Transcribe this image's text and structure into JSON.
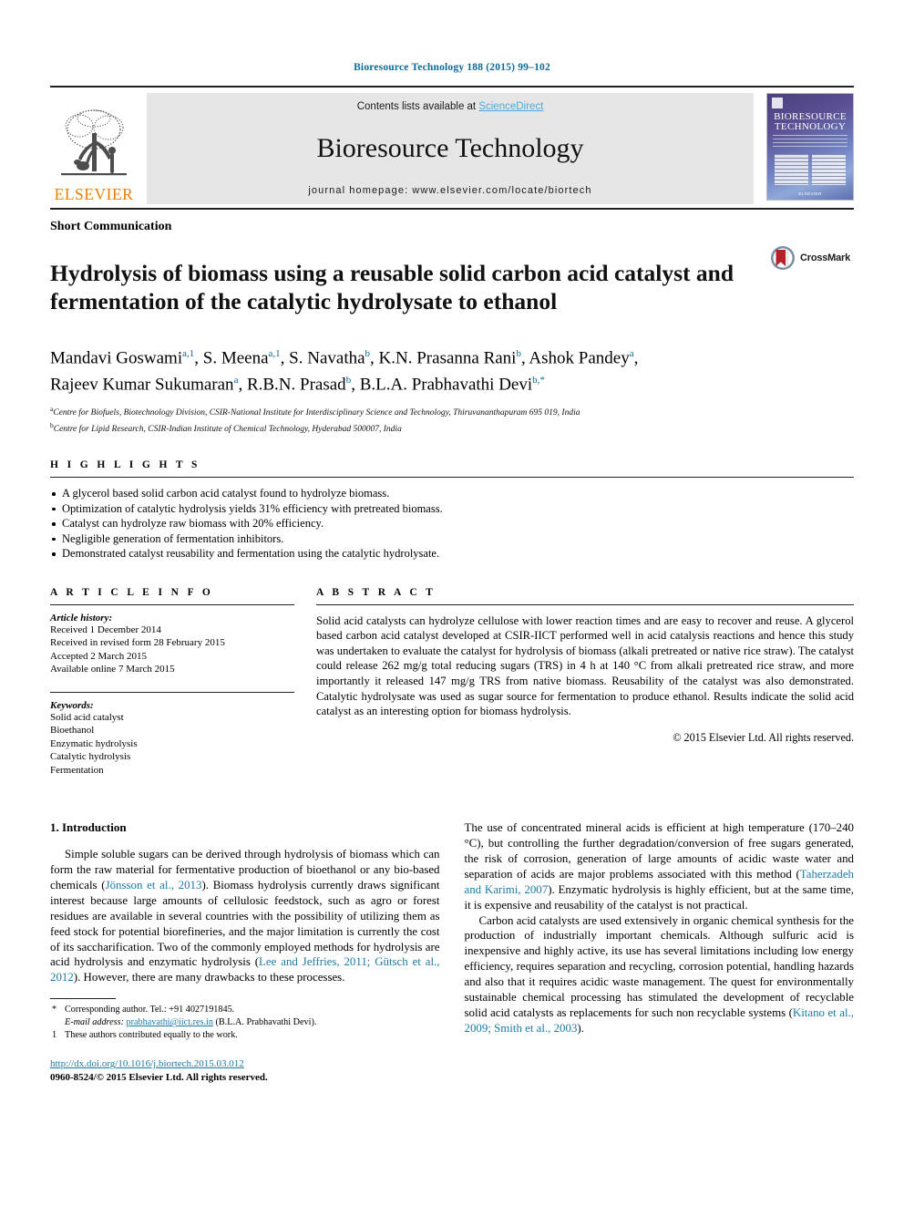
{
  "running_head": "Bioresource Technology 188 (2015) 99–102",
  "masthead": {
    "publisher_name": "ELSEVIER",
    "contents_prefix": "Contents lists available at ",
    "sciencedirect": "ScienceDirect",
    "journal_title": "Bioresource Technology",
    "homepage": "journal homepage: www.elsevier.com/locate/biortech",
    "cover_title_line1": "BIORESOURCE",
    "cover_title_line2": "TECHNOLOGY",
    "cover_footer": "ELSEVIER",
    "link_color": "#4ea7d8",
    "elsevier_orange": "#ef7d00"
  },
  "article": {
    "section_type": "Short Communication",
    "title": "Hydrolysis of biomass using a reusable solid carbon acid catalyst and fermentation of the catalytic hydrolysate to ethanol",
    "crossmark_label": "CrossMark",
    "authors_line1": "Mandavi Goswami a,1, S. Meena a,1, S. Navatha b, K.N. Prasanna Rani b, Ashok Pandey a,",
    "authors_line2": "Rajeev Kumar Sukumaran a, R.B.N. Prasad b, B.L.A. Prabhavathi Devi b,*",
    "affiliation_a": "Centre for Biofuels, Biotechnology Division, CSIR-National Institute for Interdisciplinary Science and Technology, Thiruvananthapuram 695 019, India",
    "affiliation_b": "Centre for Lipid Research, CSIR-Indian Institute of Chemical Technology, Hyderabad 500007, India"
  },
  "highlights": {
    "heading": "H I G H L I G H T S",
    "items": [
      "A glycerol based solid carbon acid catalyst found to hydrolyze biomass.",
      "Optimization of catalytic hydrolysis yields 31% efficiency with pretreated biomass.",
      "Catalyst can hydrolyze raw biomass with 20% efficiency.",
      "Negligible generation of fermentation inhibitors.",
      "Demonstrated catalyst reusability and fermentation using the catalytic hydrolysate."
    ]
  },
  "article_info": {
    "heading": "A R T I C L E    I N F O",
    "history_label": "Article history:",
    "history": [
      "Received 1 December 2014",
      "Received in revised form 28 February 2015",
      "Accepted 2 March 2015",
      "Available online 7 March 2015"
    ],
    "keywords_label": "Keywords:",
    "keywords": [
      "Solid acid catalyst",
      "Bioethanol",
      "Enzymatic hydrolysis",
      "Catalytic hydrolysis",
      "Fermentation"
    ]
  },
  "abstract": {
    "heading": "A B S T R A C T",
    "text": "Solid acid catalysts can hydrolyze cellulose with lower reaction times and are easy to recover and reuse. A glycerol based carbon acid catalyst developed at CSIR-IICT performed well in acid catalysis reactions and hence this study was undertaken to evaluate the catalyst for hydrolysis of biomass (alkali pretreated or native rice straw). The catalyst could release 262 mg/g total reducing sugars (TRS) in 4 h at 140 °C from alkali pretreated rice straw, and more importantly it released 147 mg/g TRS from native biomass. Reusability of the catalyst was also demonstrated. Catalytic hydrolysate was used as sugar source for fermentation to produce ethanol. Results indicate the solid acid catalyst as an interesting option for biomass hydrolysis.",
    "copyright": "© 2015 Elsevier Ltd. All rights reserved."
  },
  "body": {
    "section_heading": "1. Introduction",
    "left_para_1_a": "Simple soluble sugars can be derived through hydrolysis of biomass which can form the raw material for fermentative production of bioethanol or any bio-based chemicals (",
    "left_cite_1": "Jönsson et al., 2013",
    "left_para_1_b": "). Biomass hydrolysis currently draws significant interest because large amounts of cellulosic feedstock, such as agro or forest residues are available in several countries with the possibility of utilizing them as feed stock for potential biorefineries, and the major limitation is currently the cost of its saccharification. Two of the commonly employed methods for hydrolysis are acid hydrolysis and enzymatic hydrolysis (",
    "left_cite_2": "Lee and Jeffries, 2011; Gütsch et al., 2012",
    "left_para_1_c": "). However, there are many drawbacks to these processes.",
    "right_para_1_a": "The use of concentrated mineral acids is efficient at high temperature (170–240 °C), but controlling the further degradation/conversion of free sugars generated, the risk of corrosion, generation of large amounts of acidic waste water and separation of acids are major problems associated with this method (",
    "right_cite_1": "Taherzadeh and Karimi, 2007",
    "right_para_1_b": "). Enzymatic hydrolysis is highly efficient, but at the same time, it is expensive and reusability of the catalyst is not practical.",
    "right_para_2_a": "Carbon acid catalysts are used extensively in organic chemical synthesis for the production of industrially important chemicals. Although sulfuric acid is inexpensive and highly active, its use has several limitations including low energy efficiency, requires separation and recycling, corrosion potential, handling hazards and also that it requires acidic waste management. The quest for environmentally sustainable chemical processing has stimulated the development of recyclable solid acid catalysts as replacements for such non recyclable systems (",
    "right_cite_2": "Kitano et al., 2009; Smith et al., 2003",
    "right_para_2_b": ")."
  },
  "footnotes": {
    "corresponding_mark": "*",
    "corresponding": "Corresponding author. Tel.: +91 4027191845.",
    "email_label": "E-mail address:",
    "email": "prabhavathi@iict.res.in",
    "email_suffix": "(B.L.A. Prabhavathi Devi).",
    "equal_mark": "1",
    "equal_contribution": "These authors contributed equally to the work.",
    "doi": "http://dx.doi.org/10.1016/j.biortech.2015.03.012",
    "issn": "0960-8524/© 2015 Elsevier Ltd. All rights reserved."
  }
}
